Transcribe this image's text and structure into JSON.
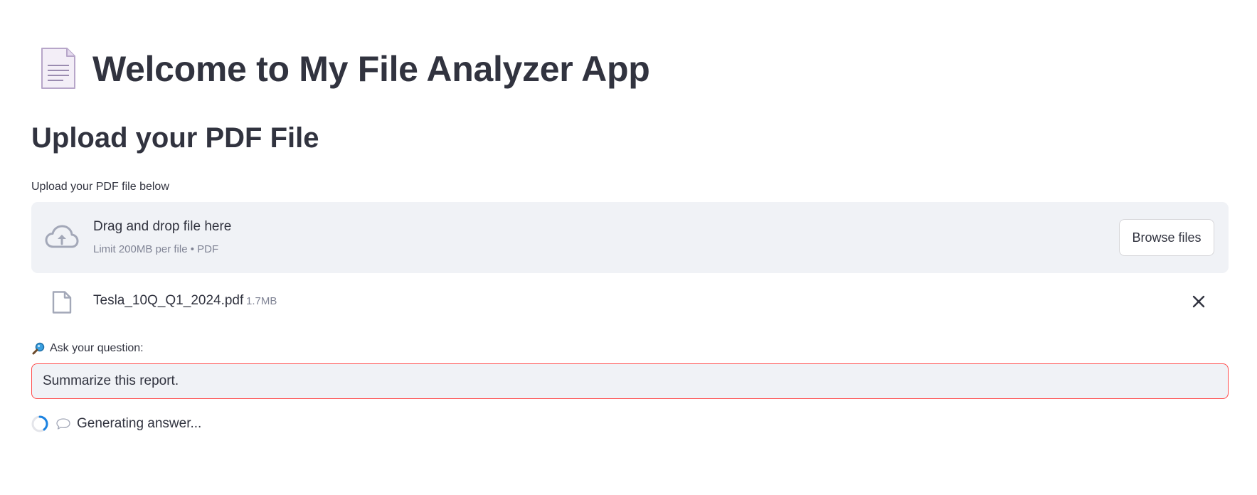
{
  "header": {
    "title": "Welcome to My File Analyzer App",
    "title_icon": "page-document-icon"
  },
  "upload_section": {
    "heading": "Upload your PDF File",
    "label": "Upload your PDF file below",
    "dropzone": {
      "title": "Drag and drop file here",
      "subtitle": "Limit 200MB per file • PDF",
      "icon": "cloud-upload-icon"
    },
    "browse_label": "Browse files"
  },
  "uploaded_file": {
    "name": "Tesla_10Q_Q1_2024.pdf",
    "size": "1.7MB",
    "icon": "file-icon"
  },
  "question": {
    "label": "Ask your question:",
    "icon": "magnifier-icon",
    "value": "Summarize this report."
  },
  "status": {
    "text": "Generating answer...",
    "icon": "speech-balloon-icon"
  },
  "colors": {
    "text": "#31333f",
    "muted": "#808495",
    "surface": "#f0f2f6",
    "focus_border": "#ff4b4b",
    "spinner_accent": "#1c83e1"
  }
}
